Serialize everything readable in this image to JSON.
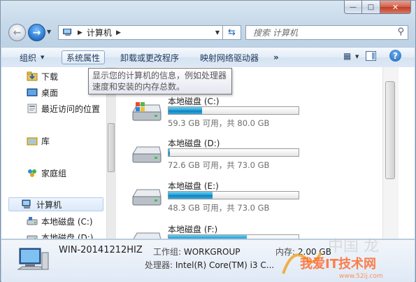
{
  "window": {
    "caption_buttons": {
      "minimize": "—",
      "maximize": "□",
      "close": "✕"
    }
  },
  "address_bar": {
    "path": [
      "计算机"
    ],
    "search_placeholder": "搜索 计算机"
  },
  "toolbar": {
    "organize": "组织",
    "system_properties": "系统属性",
    "uninstall": "卸载或更改程序",
    "map_drive": "映射网络驱动器",
    "more": "»"
  },
  "tooltip": {
    "line1": "显示您的计算机的信息，例如处理器",
    "line2": "速度和安装的内存总数。"
  },
  "nav_pane": {
    "items": [
      {
        "label": "下载",
        "icon": "download-folder-icon"
      },
      {
        "label": "桌面",
        "icon": "desktop-icon"
      },
      {
        "label": "最近访问的位置",
        "icon": "recent-places-icon"
      },
      {
        "label": "库",
        "icon": "libraries-icon"
      },
      {
        "label": "家庭组",
        "icon": "homegroup-icon"
      },
      {
        "label": "计算机",
        "icon": "computer-icon"
      },
      {
        "label": "本地磁盘 (C:)",
        "icon": "drive-icon"
      },
      {
        "label": "本地磁盘 (D:)",
        "icon": "drive-icon"
      }
    ]
  },
  "drives": [
    {
      "name": "本地磁盘 (C:)",
      "info": "59.3 GB 可用，共 80.0 GB",
      "used_fraction": 0.26
    },
    {
      "name": "本地磁盘 (D:)",
      "info": "72.6 GB 可用，共 73.0 GB",
      "used_fraction": 0.01
    },
    {
      "name": "本地磁盘 (E:)",
      "info": "48.3 GB 可用，共 73.0 GB",
      "used_fraction": 0.34
    },
    {
      "name": "本地磁盘 (F:)",
      "info": "",
      "used_fraction": 0.6
    }
  ],
  "details": {
    "computer_name": "WIN-20141212HIZ",
    "workgroup_label": "工作组:",
    "workgroup": "WORKGROUP",
    "memory_label": "内存:",
    "memory": "2.00 GB",
    "processor_label": "处理器:",
    "processor": "Intel(R) Core(TM) i3 C..."
  },
  "watermark": "我爱IT技术网 www.52ij.com",
  "colors": {
    "accent": "#1c9bd6",
    "window_frame": "#bfd3e6",
    "command_bar": "#dce8f5"
  }
}
